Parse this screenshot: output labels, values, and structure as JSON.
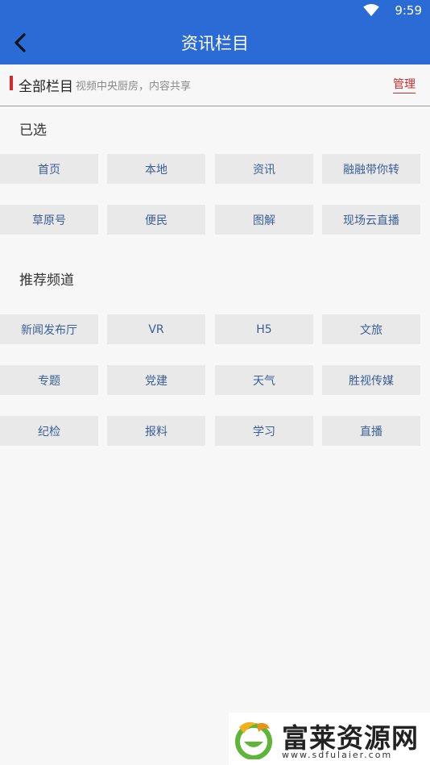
{
  "status_bar": {
    "time": "9:59",
    "wifi_icon": "wifi-icon"
  },
  "header": {
    "title": "资讯栏目",
    "back_icon": "chevron-left-icon"
  },
  "section": {
    "title": "全部栏目",
    "subtitle": "视频中央厨房，内容共享",
    "manage_label": "管理",
    "marker_color": "#d62a2a"
  },
  "selected": {
    "title": "已选",
    "items": [
      "首页",
      "本地",
      "资讯",
      "融融带你转",
      "草原号",
      "便民",
      "图解",
      "现场云直播"
    ]
  },
  "recommended": {
    "title": "推荐频道",
    "items": [
      "新闻发布厅",
      "VR",
      "H5",
      "文旅",
      "专题",
      "党建",
      "天气",
      "胜视传媒",
      "纪检",
      "报料",
      "学习",
      "直播"
    ]
  },
  "watermark": {
    "name": "富莱资源网",
    "url": "www.sdfulaier.com"
  },
  "colors": {
    "primary": "#2a6bd6",
    "chip_bg": "#e9e9e9",
    "chip_text": "#3a5f97",
    "accent_red": "#c42e2e"
  }
}
